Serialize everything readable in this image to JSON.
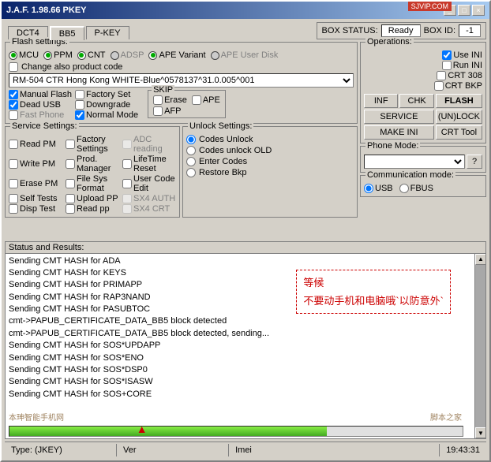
{
  "window": {
    "title": "J.A.F.  1.98.66 PKEY",
    "close": "×",
    "minimize": "_",
    "maximize": "□",
    "sjvip": "SJVIP.COM"
  },
  "tabs": [
    {
      "id": "dct4",
      "label": "DCT4",
      "active": false
    },
    {
      "id": "bb5",
      "label": "BB5",
      "active": true
    },
    {
      "id": "pkey",
      "label": "P-KEY",
      "active": false
    }
  ],
  "header": {
    "box_status_label": "BOX STATUS:",
    "box_status_value": "Ready",
    "box_id_label": "BOX ID:",
    "box_id_value": "-1"
  },
  "flash_settings": {
    "label": "Flash settings:",
    "options": [
      {
        "id": "mcu",
        "label": "MCU",
        "checked": true
      },
      {
        "id": "ppm",
        "label": "PPM",
        "checked": true
      },
      {
        "id": "cnt",
        "label": "CNT",
        "checked": true
      },
      {
        "id": "adsp",
        "label": "ADSP",
        "checked": false
      },
      {
        "id": "ape_variant",
        "label": "APE Variant",
        "checked": true
      },
      {
        "id": "ape_user_disk",
        "label": "APE User Disk",
        "checked": false
      }
    ],
    "change_product_code": "Change also product code",
    "product_code_value": "RM-504 CTR Hong Kong WHITE-Blue^0578137^31.0.005^001",
    "checkboxes": [
      {
        "id": "manual_flash",
        "label": "Manual Flash",
        "checked": true
      },
      {
        "id": "factory_set",
        "label": "Factory Set",
        "checked": false
      },
      {
        "id": "downgrade",
        "label": "Downgrade",
        "checked": false
      },
      {
        "id": "dead_usb",
        "label": "Dead USB",
        "checked": true
      },
      {
        "id": "fast_phone",
        "label": "Fast Phone",
        "checked": false
      },
      {
        "id": "normal_mode",
        "label": "Normal Mode",
        "checked": true
      }
    ],
    "skip_label": "SKIP",
    "skip_erase": "Erase",
    "skip_ape": "APE",
    "skip_afp": "AFP"
  },
  "ini_checks": {
    "use_ini": "Use INI",
    "run_ini": "Run INI",
    "crt_308": "CRT 308",
    "crt_bkp": "CRT BKP"
  },
  "operations": {
    "label": "Operations:",
    "buttons": [
      {
        "id": "inf",
        "label": "INF"
      },
      {
        "id": "chk",
        "label": "CHK"
      },
      {
        "id": "flash",
        "label": "FLASH"
      },
      {
        "id": "service",
        "label": "SERVICE"
      },
      {
        "id": "unlock",
        "label": "(UN)LOCK"
      },
      {
        "id": "make_ini",
        "label": "MAKE INI"
      },
      {
        "id": "crt_tool",
        "label": "CRT Tool"
      }
    ]
  },
  "service_settings": {
    "label": "Service Settings:",
    "items": [
      {
        "id": "read_pm",
        "label": "Read PM"
      },
      {
        "id": "factory_settings",
        "label": "Factory Settings"
      },
      {
        "id": "adc_reading",
        "label": "ADC reading",
        "disabled": true
      },
      {
        "id": "write_pm",
        "label": "Write PM"
      },
      {
        "id": "prod_manager",
        "label": "Prod. Manager"
      },
      {
        "id": "lifetime_reset",
        "label": "LifeTime Reset"
      },
      {
        "id": "erase_pm",
        "label": "Erase PM"
      },
      {
        "id": "file_sys_format",
        "label": "File Sys Format"
      },
      {
        "id": "user_code_edit",
        "label": "User Code Edit"
      },
      {
        "id": "self_tests",
        "label": "Self Tests"
      },
      {
        "id": "upload_pp",
        "label": "Upload PP"
      },
      {
        "id": "sx4_auth",
        "label": "SX4 AUTH",
        "disabled": true
      },
      {
        "id": "disp_test",
        "label": "Disp Test"
      },
      {
        "id": "read_pp",
        "label": "Read pp"
      },
      {
        "id": "sx4_crt",
        "label": "SX4 CRT",
        "disabled": true
      }
    ]
  },
  "unlock_settings": {
    "label": "Unlock Settings:",
    "options": [
      {
        "id": "codes_unlock",
        "label": "Codes Unlock",
        "checked": true
      },
      {
        "id": "codes_unlock_old",
        "label": "Codes unlock OLD",
        "checked": false
      },
      {
        "id": "enter_codes",
        "label": "Enter Codes",
        "checked": false
      },
      {
        "id": "restore_bkp",
        "label": "Restore Bkp",
        "checked": false
      }
    ]
  },
  "phone_mode": {
    "label": "Phone Mode:",
    "value": "",
    "btn": "?"
  },
  "communication": {
    "label": "Communication mode:",
    "usb": "USB",
    "fbus": "FBUS",
    "usb_checked": true
  },
  "status": {
    "label": "Status and Results:",
    "log_lines": [
      "Sending CMT HASH for ADA",
      "Sending CMT HASH for KEYS",
      "Sending CMT HASH for PRIMAPP",
      "Sending CMT HASH for RAP3NAND",
      "Sending CMT HASH for PASUBTOC",
      "cmt->PAPUB_CERTIFICATE_DATA_BB5 block detected",
      "cmt->PAPUB_CERTIFICATE_DATA_BB5 block detected, sending...",
      "Sending CMT HASH for SOS*UPDAPP",
      "Sending CMT HASH for SOS*ENO",
      "Sending CMT HASH for SOS*DSP0",
      "Sending CMT HASH for SOS*ISASW",
      "Sending CMT HASH for SOS+CORE"
    ],
    "chinese_line1": "等候",
    "chinese_line2": "不要动手机和电脑哦`以防意外`",
    "watermark_left": "本珅智能手机网",
    "watermark_right": "脚本之家"
  },
  "bottom_bar": {
    "type_label": "Type: (JKEY)",
    "ver_label": "Ver",
    "imei_label": "Imei",
    "time": "19:43:31"
  }
}
